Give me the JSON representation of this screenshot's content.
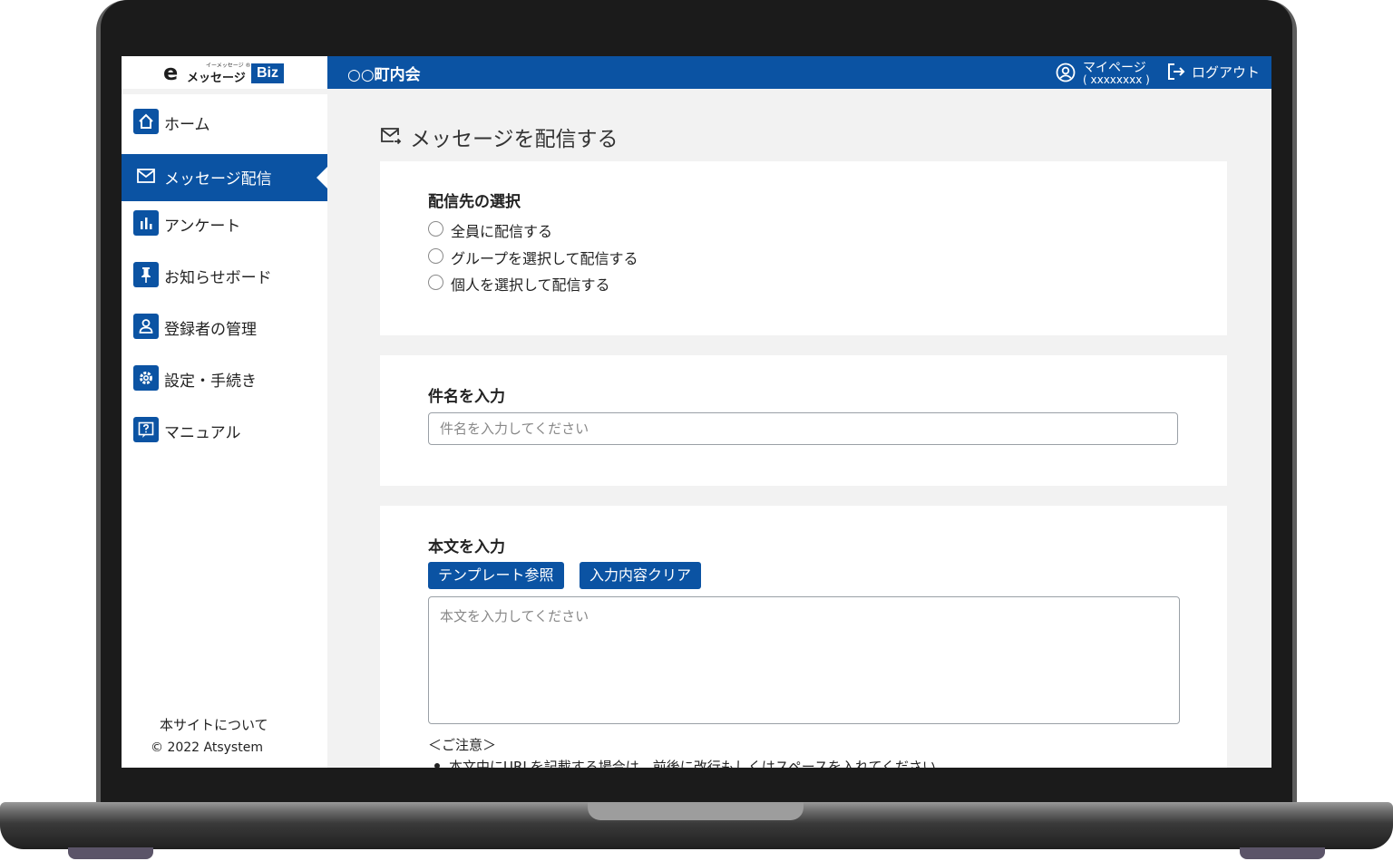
{
  "header": {
    "logo_e": "e",
    "logo_ruby": "イーメッセージ ®",
    "logo_text": "メッセージ",
    "logo_biz": "Biz",
    "org_name": "○○町内会",
    "mypage_label": "マイページ",
    "mypage_id": "( xxxxxxxx )",
    "logout_label": "ログアウト"
  },
  "sidebar": {
    "items": [
      {
        "label": "ホーム",
        "icon": "home-icon"
      },
      {
        "label": "メッセージ配信",
        "icon": "mail-icon",
        "active": true
      },
      {
        "label": "アンケート",
        "icon": "bar-chart-icon"
      },
      {
        "label": "お知らせボード",
        "icon": "pin-icon"
      },
      {
        "label": "登録者の管理",
        "icon": "user-icon"
      },
      {
        "label": "設定・手続き",
        "icon": "gear-icon"
      },
      {
        "label": "マニュアル",
        "icon": "help-icon"
      }
    ],
    "about": "本サイトについて",
    "copyright": "© 2022 Atsystem"
  },
  "main": {
    "page_title": "メッセージを配信する",
    "recipient": {
      "title": "配信先の選択",
      "options": [
        "全員に配信する",
        "グループを選択して配信する",
        "個人を選択して配信する"
      ]
    },
    "subject": {
      "title": "件名を入力",
      "placeholder": "件名を入力してください"
    },
    "body": {
      "title": "本文を入力",
      "template_button": "テンプレート参照",
      "clear_button": "入力内容クリア",
      "placeholder": "本文を入力してください",
      "notice_title": "＜ご注意＞",
      "notice_items": [
        "本文中にURLを記載する場合は、前後に改行もしくはスペースを入れてください"
      ]
    }
  },
  "colors": {
    "brand": "#0b53a3",
    "background": "#f2f2f2"
  }
}
